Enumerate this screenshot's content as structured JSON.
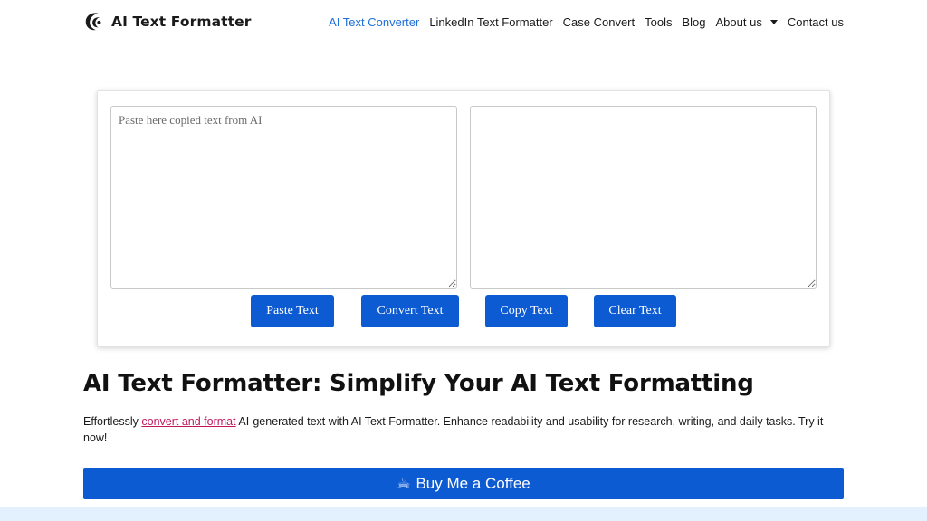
{
  "brand": {
    "name": "AI Text Formatter",
    "icon": "logo-swirl-icon"
  },
  "nav": {
    "items": [
      {
        "label": "AI Text Converter",
        "active": true
      },
      {
        "label": "LinkedIn Text Formatter",
        "active": false
      },
      {
        "label": "Case Convert",
        "active": false
      },
      {
        "label": "Tools",
        "active": false
      },
      {
        "label": "Blog",
        "active": false
      },
      {
        "label": "About us",
        "active": false,
        "has_dropdown": true
      },
      {
        "label": "Contact us",
        "active": false
      }
    ]
  },
  "tool": {
    "input_placeholder": "Paste here copied text from AI",
    "input_value": "",
    "output_value": "",
    "buttons": {
      "paste": "Paste Text",
      "convert": "Convert Text",
      "copy": "Copy Text",
      "clear": "Clear Text"
    }
  },
  "content": {
    "heading": "AI Text Formatter: Simplify Your AI Text Formatting",
    "desc_before": "Effortlessly ",
    "desc_link": "convert and format",
    "desc_after": " AI-generated text with AI Text Formatter. Enhance readability and usability for research, writing, and daily tasks. Try it now!",
    "coffee_icon": "☕",
    "coffee_label": "Buy Me a Coffee"
  },
  "colors": {
    "accent": "#0d5bd3",
    "active_link": "#1e6fd9",
    "inline_link": "#c2185b",
    "bottom_band": "#e3f0fd"
  }
}
